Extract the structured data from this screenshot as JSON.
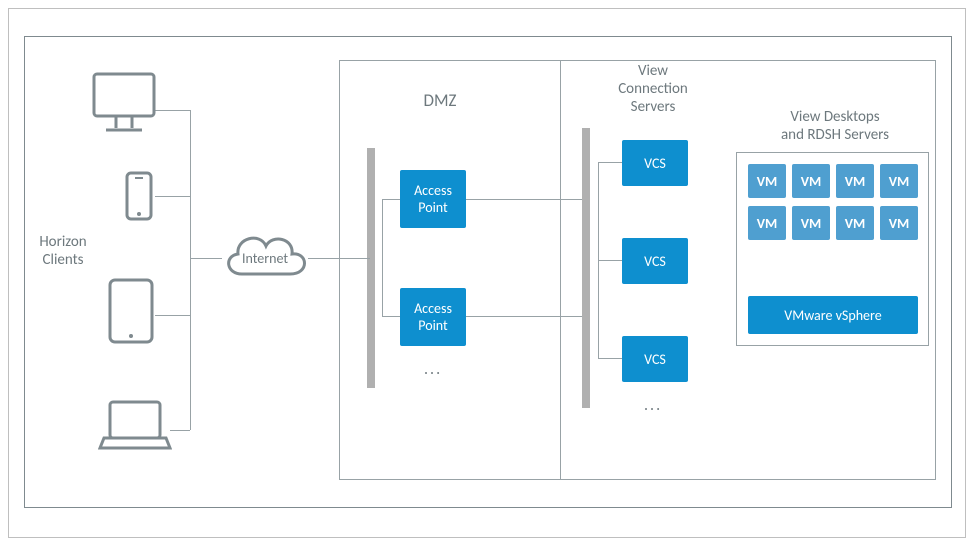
{
  "labels": {
    "horizon_clients": "Horizon\nClients",
    "internet": "Internet",
    "dmz": "DMZ",
    "view_conn_servers": "View\nConnection\nServers",
    "view_desktops": "View Desktops\nand RDSH Servers"
  },
  "boxes": {
    "access_point": "Access\nPoint",
    "vcs": "VCS",
    "vm": "VM",
    "vmware_vsphere": "VMware vSphere"
  },
  "misc": {
    "ellipsis": "..."
  },
  "colors": {
    "line": "#98a2a6",
    "text": "#6d787d",
    "blue": "#0e8fcf",
    "vm": "#4f9fd0",
    "bar": "#b0b0b0",
    "frame": "#7f8a8f"
  }
}
